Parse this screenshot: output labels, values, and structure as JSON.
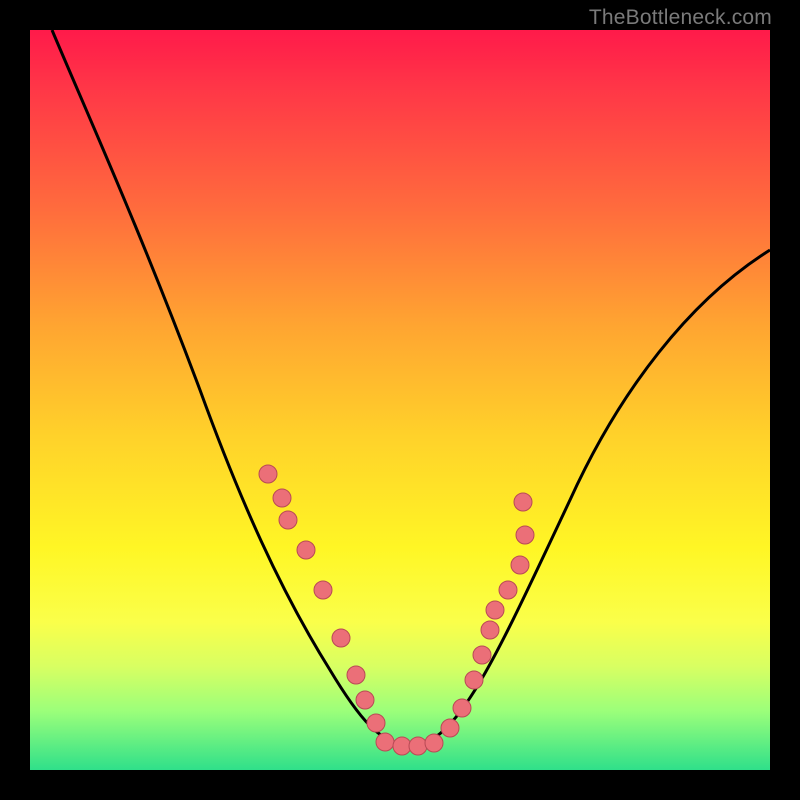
{
  "watermark": "TheBottleneck.com",
  "chart_data": {
    "type": "line",
    "title": "",
    "xlabel": "",
    "ylabel": "",
    "xlim": [
      0,
      100
    ],
    "ylim": [
      0,
      100
    ],
    "grid": false,
    "series": [
      {
        "name": "bottleneck-curve",
        "x": [
          3,
          8,
          14,
          20,
          26,
          31,
          35,
          39,
          42,
          45,
          47.5,
          50,
          52.5,
          55,
          58,
          62,
          66,
          71,
          77,
          84,
          92,
          100
        ],
        "y": [
          100,
          88,
          75,
          62,
          50,
          40,
          32,
          25,
          18,
          12,
          7,
          4,
          3,
          3,
          4.5,
          9,
          15,
          23,
          33,
          45,
          58,
          70
        ]
      },
      {
        "name": "data-points",
        "x": [
          32,
          34,
          37,
          39.5,
          42,
          44,
          47,
          51,
          55,
          58,
          60.5,
          61.5,
          63,
          64.5
        ],
        "y": [
          40,
          37,
          30,
          24,
          18,
          13,
          6,
          4,
          5,
          9,
          13,
          16,
          20,
          24
        ]
      },
      {
        "name": "flat-bottom-points",
        "x": [
          48,
          50,
          52,
          54
        ],
        "y": [
          3.5,
          3,
          3,
          3.5
        ]
      }
    ]
  }
}
